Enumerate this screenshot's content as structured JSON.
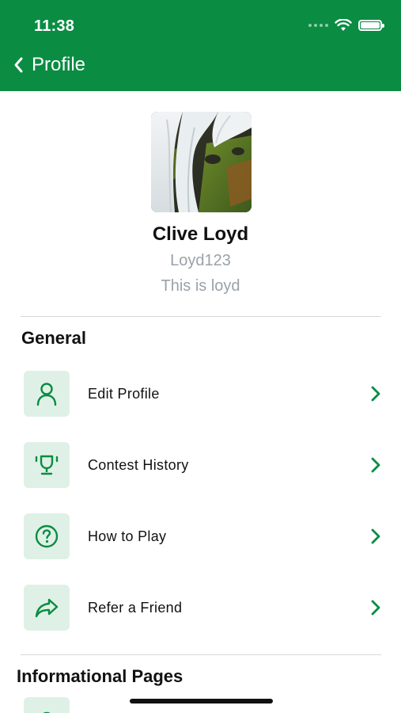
{
  "status_bar": {
    "time": "11:38"
  },
  "header": {
    "title": "Profile"
  },
  "profile": {
    "name": "Clive Loyd",
    "username": "Loyd123",
    "bio": "This is loyd"
  },
  "sections": {
    "general": {
      "title": "General",
      "items": [
        {
          "label": "Edit Profile",
          "icon": "user-icon"
        },
        {
          "label": "Contest History",
          "icon": "trophy-icon"
        },
        {
          "label": "How to Play",
          "icon": "question-circle-icon"
        },
        {
          "label": "Refer a Friend",
          "icon": "share-arrow-icon"
        }
      ]
    },
    "informational": {
      "title": "Informational Pages"
    }
  },
  "colors": {
    "brand_green": "#0a8c43",
    "icon_bg": "#dff1e6",
    "muted_text": "#9aa1a9"
  }
}
